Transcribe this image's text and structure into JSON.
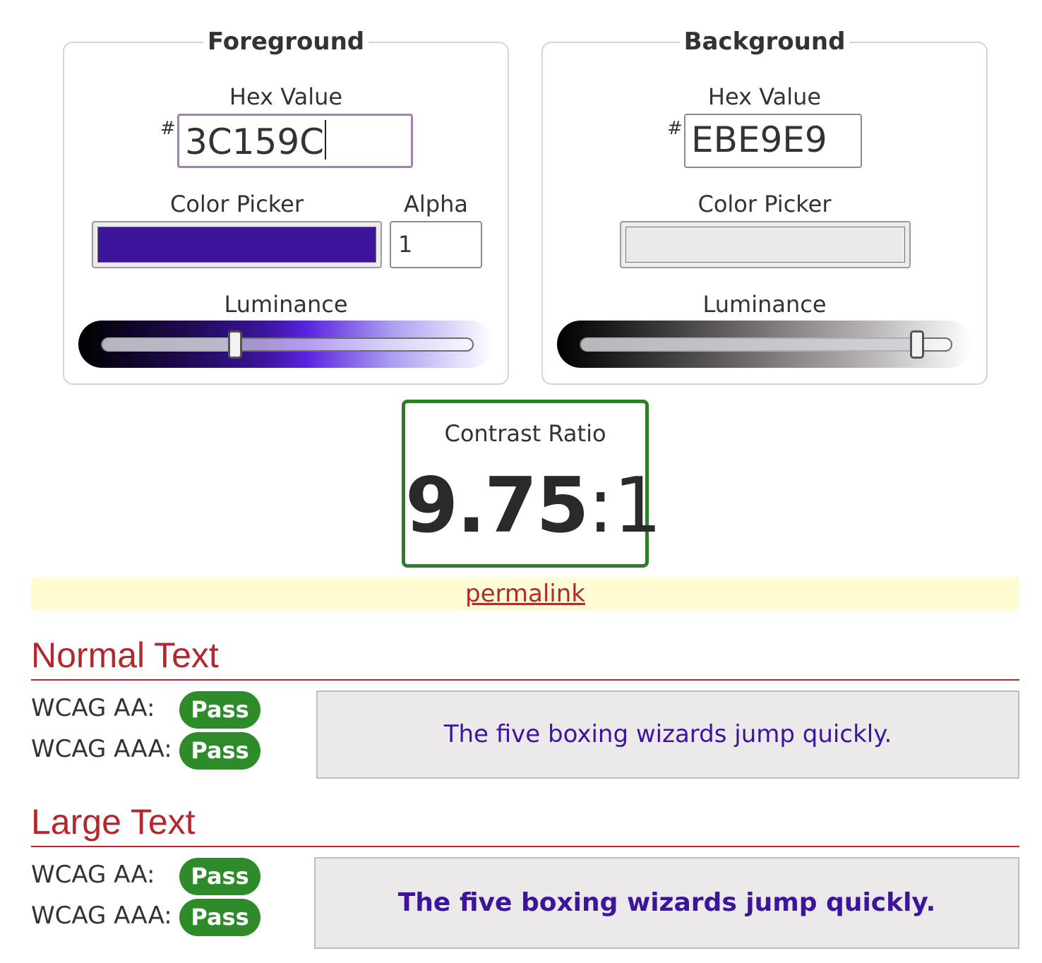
{
  "foreground": {
    "legend": "Foreground",
    "hex_label": "Hex Value",
    "hash": "#",
    "hex_value": "3C159C",
    "picker_label": "Color Picker",
    "alpha_label": "Alpha",
    "alpha_value": "1",
    "luminance_label": "Luminance",
    "luminance_level": 0.36,
    "color": "#3C159C"
  },
  "background": {
    "legend": "Background",
    "hex_label": "Hex Value",
    "hash": "#",
    "hex_value": "EBE9E9",
    "picker_label": "Color Picker",
    "luminance_label": "Luminance",
    "luminance_level": 0.905,
    "color": "#EBE9E9"
  },
  "contrast": {
    "label": "Contrast Ratio",
    "ratio": "9.75",
    "suffix": ":1",
    "border_color": "#2E7D2A"
  },
  "permalink": "permalink",
  "normal_text": {
    "title": "Normal Text",
    "aa_label": "WCAG AA:",
    "aa_result": "Pass",
    "aaa_label": "WCAG AAA:",
    "aaa_result": "Pass",
    "sample": "The five boxing wizards jump quickly."
  },
  "large_text": {
    "title": "Large Text",
    "aa_label": "WCAG AA:",
    "aa_result": "Pass",
    "aaa_label": "WCAG AAA:",
    "aaa_result": "Pass",
    "sample": "The five boxing wizards jump quickly."
  },
  "colors": {
    "pass_badge": "#2E8B2A",
    "section_title": "#B2282C",
    "permalink_bar": "#FEFCD2"
  }
}
